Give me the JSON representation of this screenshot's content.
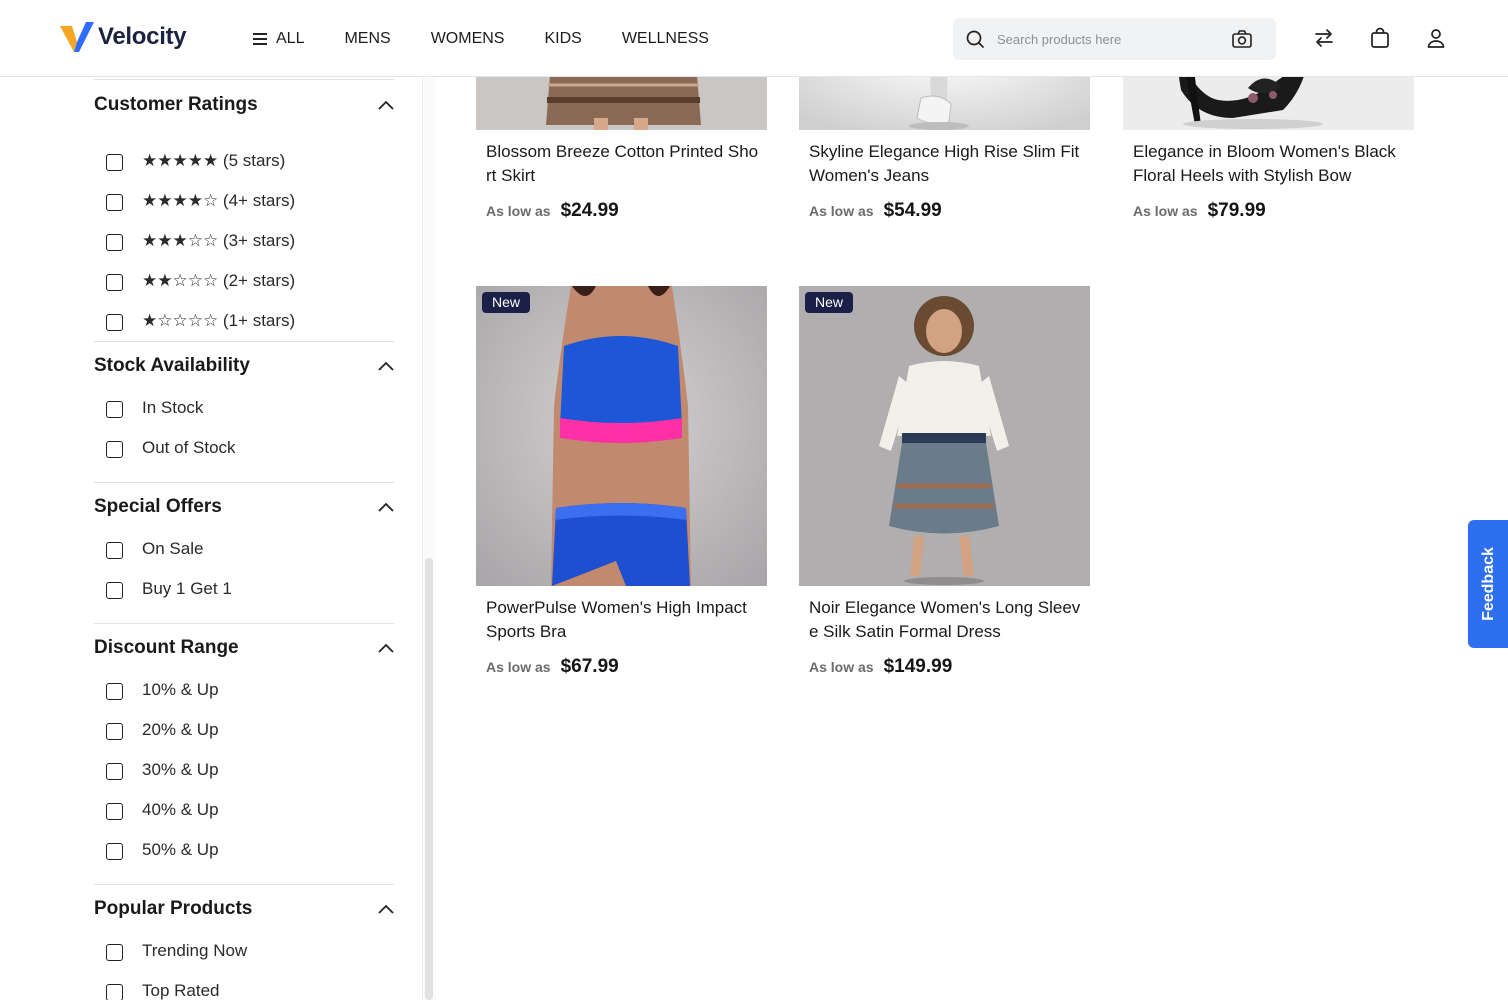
{
  "brand": {
    "name": "Velocity"
  },
  "nav": {
    "items": [
      {
        "label": "ALL"
      },
      {
        "label": "MENS"
      },
      {
        "label": "WOMENS"
      },
      {
        "label": "KIDS"
      },
      {
        "label": "WELLNESS"
      }
    ]
  },
  "search": {
    "placeholder": "Search products here"
  },
  "filters": {
    "customer_ratings": {
      "title": "Customer Ratings",
      "options": [
        "★★★★★ (5 stars)",
        "★★★★☆ (4+ stars)",
        "★★★☆☆ (3+ stars)",
        "★★☆☆☆ (2+ stars)",
        "★☆☆☆☆ (1+ stars)"
      ]
    },
    "stock": {
      "title": "Stock Availability",
      "options": [
        "In Stock",
        "Out of Stock"
      ]
    },
    "offers": {
      "title": "Special Offers",
      "options": [
        "On Sale",
        "Buy 1 Get 1"
      ]
    },
    "discount": {
      "title": "Discount Range",
      "options": [
        "10% & Up",
        "20% & Up",
        "30% & Up",
        "40% & Up",
        "50% & Up"
      ]
    },
    "popular": {
      "title": "Popular Products",
      "options": [
        "Trending Now",
        "Top Rated"
      ]
    }
  },
  "products": [
    {
      "name": "Blossom Breeze Cotton Printed Short Skirt",
      "price_prefix": "As low as",
      "price": "$24.99"
    },
    {
      "name": "Skyline Elegance High Rise Slim Fit Women's Jeans",
      "price_prefix": "As low as",
      "price": "$54.99"
    },
    {
      "name": "Elegance in Bloom Women's Black Floral Heels with Stylish Bow",
      "price_prefix": "As low as",
      "price": "$79.99"
    },
    {
      "badge": "New",
      "name": "PowerPulse Women's High Impact Sports Bra",
      "price_prefix": "As low as",
      "price": "$67.99"
    },
    {
      "badge": "New",
      "name": "Noir Elegance Women's Long Sleeve Silk Satin Formal Dress",
      "price_prefix": "As low as",
      "price": "$149.99"
    }
  ],
  "feedback": {
    "label": "Feedback"
  },
  "colors": {
    "accent": "#2d6ff0",
    "badge": "#1a2047",
    "logo_orange": "#f5a623",
    "logo_blue": "#2f6bff"
  }
}
